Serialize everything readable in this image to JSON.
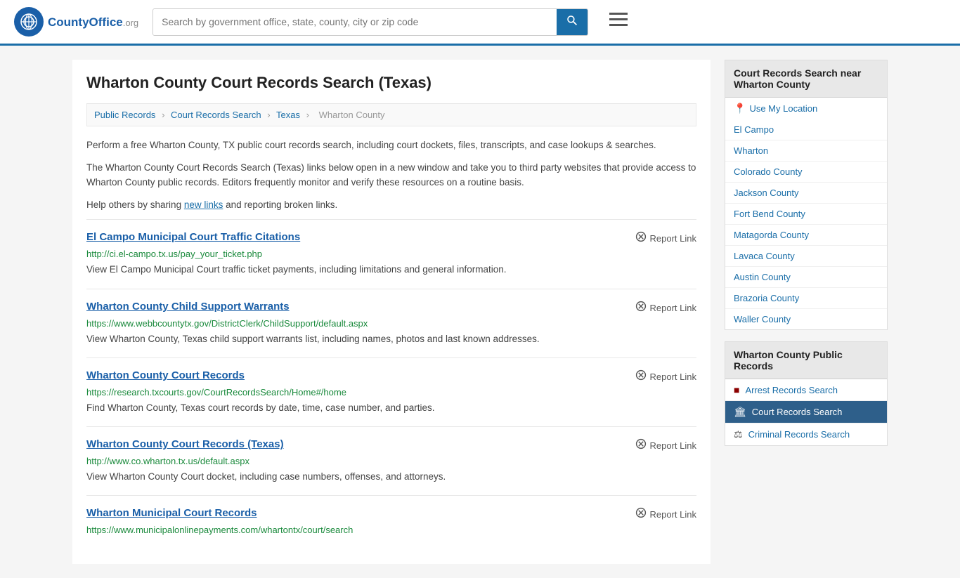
{
  "header": {
    "logo_text": "CountyOffice",
    "logo_suffix": ".org",
    "search_placeholder": "Search by government office, state, county, city or zip code",
    "search_button_label": "🔍"
  },
  "page": {
    "title": "Wharton County Court Records Search (Texas)",
    "breadcrumb": {
      "items": [
        "Public Records",
        "Court Records Search",
        "Texas",
        "Wharton County"
      ]
    },
    "description1": "Perform a free Wharton County, TX public court records search, including court dockets, files, transcripts, and case lookups & searches.",
    "description2": "The Wharton County Court Records Search (Texas) links below open in a new window and take you to third party websites that provide access to Wharton County public records. Editors frequently monitor and verify these resources on a routine basis.",
    "description3_pre": "Help others by sharing ",
    "description3_link": "new links",
    "description3_post": " and reporting broken links."
  },
  "results": [
    {
      "title": "El Campo Municipal Court Traffic Citations",
      "url": "http://ci.el-campo.tx.us/pay_your_ticket.php",
      "description": "View El Campo Municipal Court traffic ticket payments, including limitations and general information.",
      "report_label": "Report Link"
    },
    {
      "title": "Wharton County Child Support Warrants",
      "url": "https://www.webbcountytx.gov/DistrictClerk/ChildSupport/default.aspx",
      "description": "View Wharton County, Texas child support warrants list, including names, photos and last known addresses.",
      "report_label": "Report Link"
    },
    {
      "title": "Wharton County Court Records",
      "url": "https://research.txcourts.gov/CourtRecordsSearch/Home#/home",
      "description": "Find Wharton County, Texas court records by date, time, case number, and parties.",
      "report_label": "Report Link"
    },
    {
      "title": "Wharton County Court Records (Texas)",
      "url": "http://www.co.wharton.tx.us/default.aspx",
      "description": "View Wharton County Court docket, including case numbers, offenses, and attorneys.",
      "report_label": "Report Link"
    },
    {
      "title": "Wharton Municipal Court Records",
      "url": "https://www.municipalonlinepayments.com/whartontx/court/search",
      "description": "",
      "report_label": "Report Link"
    }
  ],
  "sidebar": {
    "nearby_header": "Court Records Search near Wharton County",
    "use_location": "Use My Location",
    "nearby_links": [
      "El Campo",
      "Wharton",
      "Colorado County",
      "Jackson County",
      "Fort Bend County",
      "Matagorda County",
      "Lavaca County",
      "Austin County",
      "Brazoria County",
      "Waller County"
    ],
    "public_records_header": "Wharton County Public Records",
    "public_records": [
      {
        "label": "Arrest Records Search",
        "icon": "■",
        "active": false
      },
      {
        "label": "Court Records Search",
        "icon": "🏛",
        "active": true
      },
      {
        "label": "Criminal Records Search",
        "icon": "⚖",
        "active": false
      }
    ]
  }
}
